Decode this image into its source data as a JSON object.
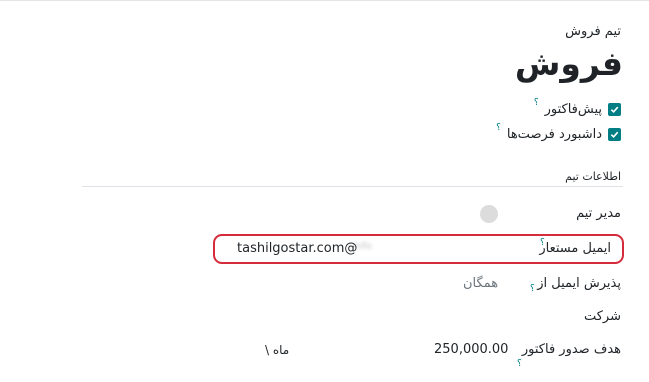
{
  "header": {
    "team_label": "تیم فروش",
    "team_name": "فروش"
  },
  "options": [
    {
      "label": "پیش‌فاکتور",
      "help": "؟",
      "checked": true
    },
    {
      "label": "داشبورد فرصت‌ها",
      "help": "؟",
      "checked": true
    }
  ],
  "section": {
    "title": "اطلاعات تیم"
  },
  "fields": {
    "manager_label": "مدیر تیم",
    "email_alias_label": "ایمیل مستعار",
    "email_alias_help": "؟",
    "email_alias_domain": "tashilgostar.com@",
    "email_alias_value_blurred": "info",
    "accept_emails_label": "پذیرش ایمیل از",
    "accept_emails_help": "؟",
    "accept_emails_value": "همگان",
    "company_label": "شرکت",
    "invoice_target_label": "هدف صدور فاکتور",
    "invoice_target_help": "؟",
    "invoice_target_value": "250,000.00",
    "invoice_target_period": "\\ ماه"
  },
  "colors": {
    "checkbox": "#017e84",
    "highlight": "#d62b3a",
    "avatar": "#dcdcdc"
  }
}
